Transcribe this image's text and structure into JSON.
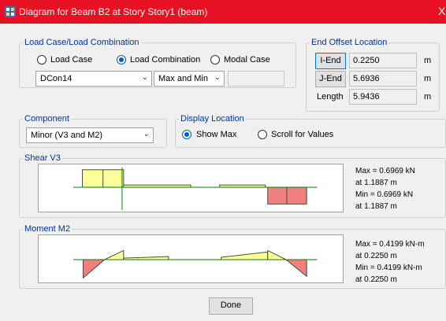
{
  "window": {
    "title": "Diagram for Beam B2 at Story Story1 (beam)",
    "close_glyph": "X"
  },
  "load_case": {
    "group_label": "Load Case/Load Combination",
    "radio_load_case": "Load Case",
    "radio_load_combination": "Load Combination",
    "radio_modal_case": "Modal Case",
    "selected_radio": "Load Combination",
    "combo_value": "DCon14",
    "type_value": "Max and Min",
    "third_value": ""
  },
  "end_offset": {
    "group_label": "End Offset Location",
    "i_end_label": "I-End",
    "i_end_value": "0.2250",
    "i_end_unit": "m",
    "j_end_label": "J-End",
    "j_end_value": "5.6936",
    "j_end_unit": "m",
    "length_label": "Length",
    "length_value": "5.9436",
    "length_unit": "m"
  },
  "component": {
    "group_label": "Component",
    "value": "Minor (V3 and M2)"
  },
  "display_location": {
    "group_label": "Display Location",
    "show_max": "Show Max",
    "scroll_for_values": "Scroll for Values",
    "selected": "Show Max"
  },
  "shear": {
    "group_label": "Shear V3",
    "max_text": "Max = 0.6969 kN",
    "max_at": "at 1.1887 m",
    "min_text": "Min = 0.6969 kN",
    "min_at": "at 1.1887 m"
  },
  "moment": {
    "group_label": "Moment M2",
    "max_text": "Max = 0.4199 kN-m",
    "max_at": "at 0.2250 m",
    "min_text": "Min = 0.4199 kN-m",
    "min_at": "at 0.2250 m"
  },
  "done_label": "Done",
  "colors": {
    "title_bar": "#e81123",
    "positive_fill": "#ffff99",
    "negative_fill": "#f08080",
    "baseline": "#008000",
    "group_label": "#003399"
  },
  "icons": {
    "app": "app-icon",
    "close": "close-icon",
    "dropdown": "chevron-down-icon"
  }
}
